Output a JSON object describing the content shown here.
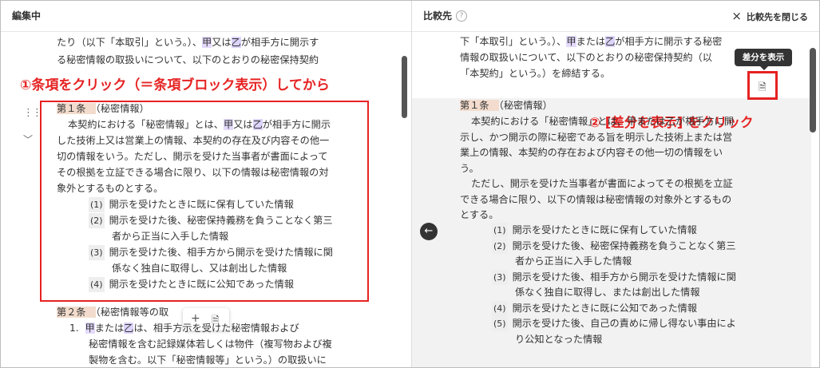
{
  "left": {
    "title": "編集中",
    "instruction": "①条項をクリック（＝条項ブロック表示）してから",
    "top_lines": [
      [
        "",
        "たり（以下「本取引」という。）、",
        "甲",
        "又は",
        "乙",
        "が相手方に開示す"
      ],
      [
        "る秘密情報の取扱いについて、以下のとおりの秘密保持契約"
      ]
    ],
    "article1": {
      "heading": "第１条",
      "subtitle": "（秘密情報）",
      "body": [
        [
          "本契約における「秘密情報」とは、",
          "甲",
          "又は",
          "乙",
          "が相手方に開示"
        ],
        [
          "した技術上又は営業上の情報、本契約の存在及び内容その他一"
        ],
        [
          "切の情報をいう。ただし、開示を受けた当事者が書面によって"
        ],
        [
          "その根拠を立証できる場合に限り、以下の情報は秘密情報の対"
        ],
        [
          "象外とするものとする。"
        ]
      ],
      "items": [
        {
          "num": "(1)",
          "lines": [
            "開示を受けたときに既に保有していた情報"
          ]
        },
        {
          "num": "(2)",
          "lines": [
            "開示を受けた後、秘密保持義務を負うことなく第三",
            "者から正当に入手した情報"
          ]
        },
        {
          "num": "(3)",
          "lines": [
            "開示を受けた後、相手方から開示を受けた情報に関",
            "係なく独自に取得し、又は創出した情報"
          ]
        },
        {
          "num": "(4)",
          "lines": [
            "開示を受けたときに既に公知であった情報"
          ]
        }
      ]
    },
    "article2": {
      "heading": "第２条",
      "subtitle": "（秘密情報等の取",
      "item1_num": "1.",
      "item1_lines": [
        [
          "甲",
          "または",
          "乙",
          "は、相手方",
          "示を受けた秘密情報および"
        ],
        [
          "秘密情報を含む記録媒体若しくは物件（複写物および複"
        ],
        [
          "製物を含む。以下「秘密情報等」という。）の取扱いに"
        ]
      ]
    },
    "toolbar": {
      "add": "+",
      "doc": "🗎"
    }
  },
  "right": {
    "title": "比較先",
    "help": "?",
    "close_label": "比較先を閉じる",
    "close_icon": "×",
    "tooltip": "差分を表示",
    "instruction": "② [差分を表示] をクリック",
    "top_lines": [
      [
        "下「本取引」という。）、",
        "甲",
        "または",
        "乙",
        "が相手方に開示する秘密"
      ],
      [
        "情報の取扱いについて、以下のとおりの秘密保持契約（以"
      ],
      [
        "「本契約」という。）を締結する。"
      ]
    ],
    "article1": {
      "heading": "第１条",
      "subtitle": "（秘密情報）",
      "body": [
        "本契約における「秘密情報」とは、甲または乙が相手方に開",
        "示し、かつ開示の際に秘密である旨を明示した技術上または営",
        "業上の情報、本契約の存在および内容その他一切の情報をい",
        "う。",
        "ただし、開示を受けた当事者が書面によってその根拠を立証",
        "できる場合に限り、以下の情報は秘密情報の対象外とするもの",
        "とする。"
      ],
      "items": [
        {
          "num": "(1)",
          "lines": [
            "開示を受けたときに既に保有していた情報"
          ]
        },
        {
          "num": "(2)",
          "lines": [
            "開示を受けた後、秘密保持義務を負うことなく第三",
            "者から正当に入手した情報"
          ]
        },
        {
          "num": "(3)",
          "lines": [
            "開示を受けた後、相手方から開示を受けた情報に関",
            "係なく独自に取得し、または創出した情報"
          ]
        },
        {
          "num": "(4)",
          "lines": [
            "開示を受けたときに既に公知であった情報"
          ]
        },
        {
          "num": "(5)",
          "lines": [
            "開示を受けた後、自己の責めに帰し得ない事由によ",
            "り公知となった情報"
          ]
        }
      ]
    }
  },
  "colors": {
    "accent_red": "#e62222",
    "party_highlight": "#e4dafc",
    "heading_highlight": "#f3dccd"
  }
}
